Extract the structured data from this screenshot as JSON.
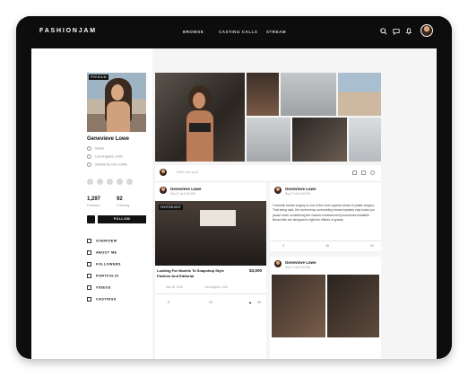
{
  "brand": {
    "logo": "FASHIONJAM"
  },
  "nav": {
    "browse": "BROWSE",
    "casting_calls": "CASTING CALLS",
    "stream": "STREAM"
  },
  "profile": {
    "badge": "PREMIUM",
    "name": "Genevieve Lowe",
    "role": "Model",
    "location": "Los Angeles, USA",
    "website": "WEBSITE ON LOWE",
    "followers_count": "1,297",
    "followers_label": "Followers",
    "following_count": "92",
    "following_label": "Following",
    "follow_label": "FOLLOW"
  },
  "menu": [
    {
      "label": "OVERVIEW",
      "icon": "overview-icon"
    },
    {
      "label": "ABOUT ME",
      "icon": "about-icon"
    },
    {
      "label": "FOLLOWERS",
      "icon": "followers-icon"
    },
    {
      "label": "PORTFOLIO",
      "icon": "portfolio-icon"
    },
    {
      "label": "VIDEOS",
      "icon": "video-icon"
    },
    {
      "label": "CASTINGS",
      "icon": "castings-icon"
    }
  ],
  "composer": {
    "placeholder": "Write new post"
  },
  "post1": {
    "author": "Genevieve Lowe",
    "time": "Sep 17 at 11:20 PM",
    "tag": "PHOTOSHOOT",
    "title": "Looking For Models To Snapshop Style Fashion And Editorial",
    "price": "$3,000",
    "date": "Mar 18, 2016",
    "location": "Los Angeles, USA",
    "shares": "8",
    "comments": "24",
    "likes": "45"
  },
  "post2": {
    "author": "Genevieve Lowe",
    "time": "Sep 17 at 11:20 PM",
    "text": "Cosmetic breast surgery is one of the more popular areas of plastic surgery. That being said, the controversy surrounding breast implants may make you pause when considering the various enhancement procedures available. Breast lifts are designed to fight the effects of gravity.",
    "shares": "3",
    "comments": "18",
    "likes": "12"
  },
  "post3": {
    "author": "Genevieve Lowe",
    "time": "Sep 17 at 07:02 AM"
  }
}
